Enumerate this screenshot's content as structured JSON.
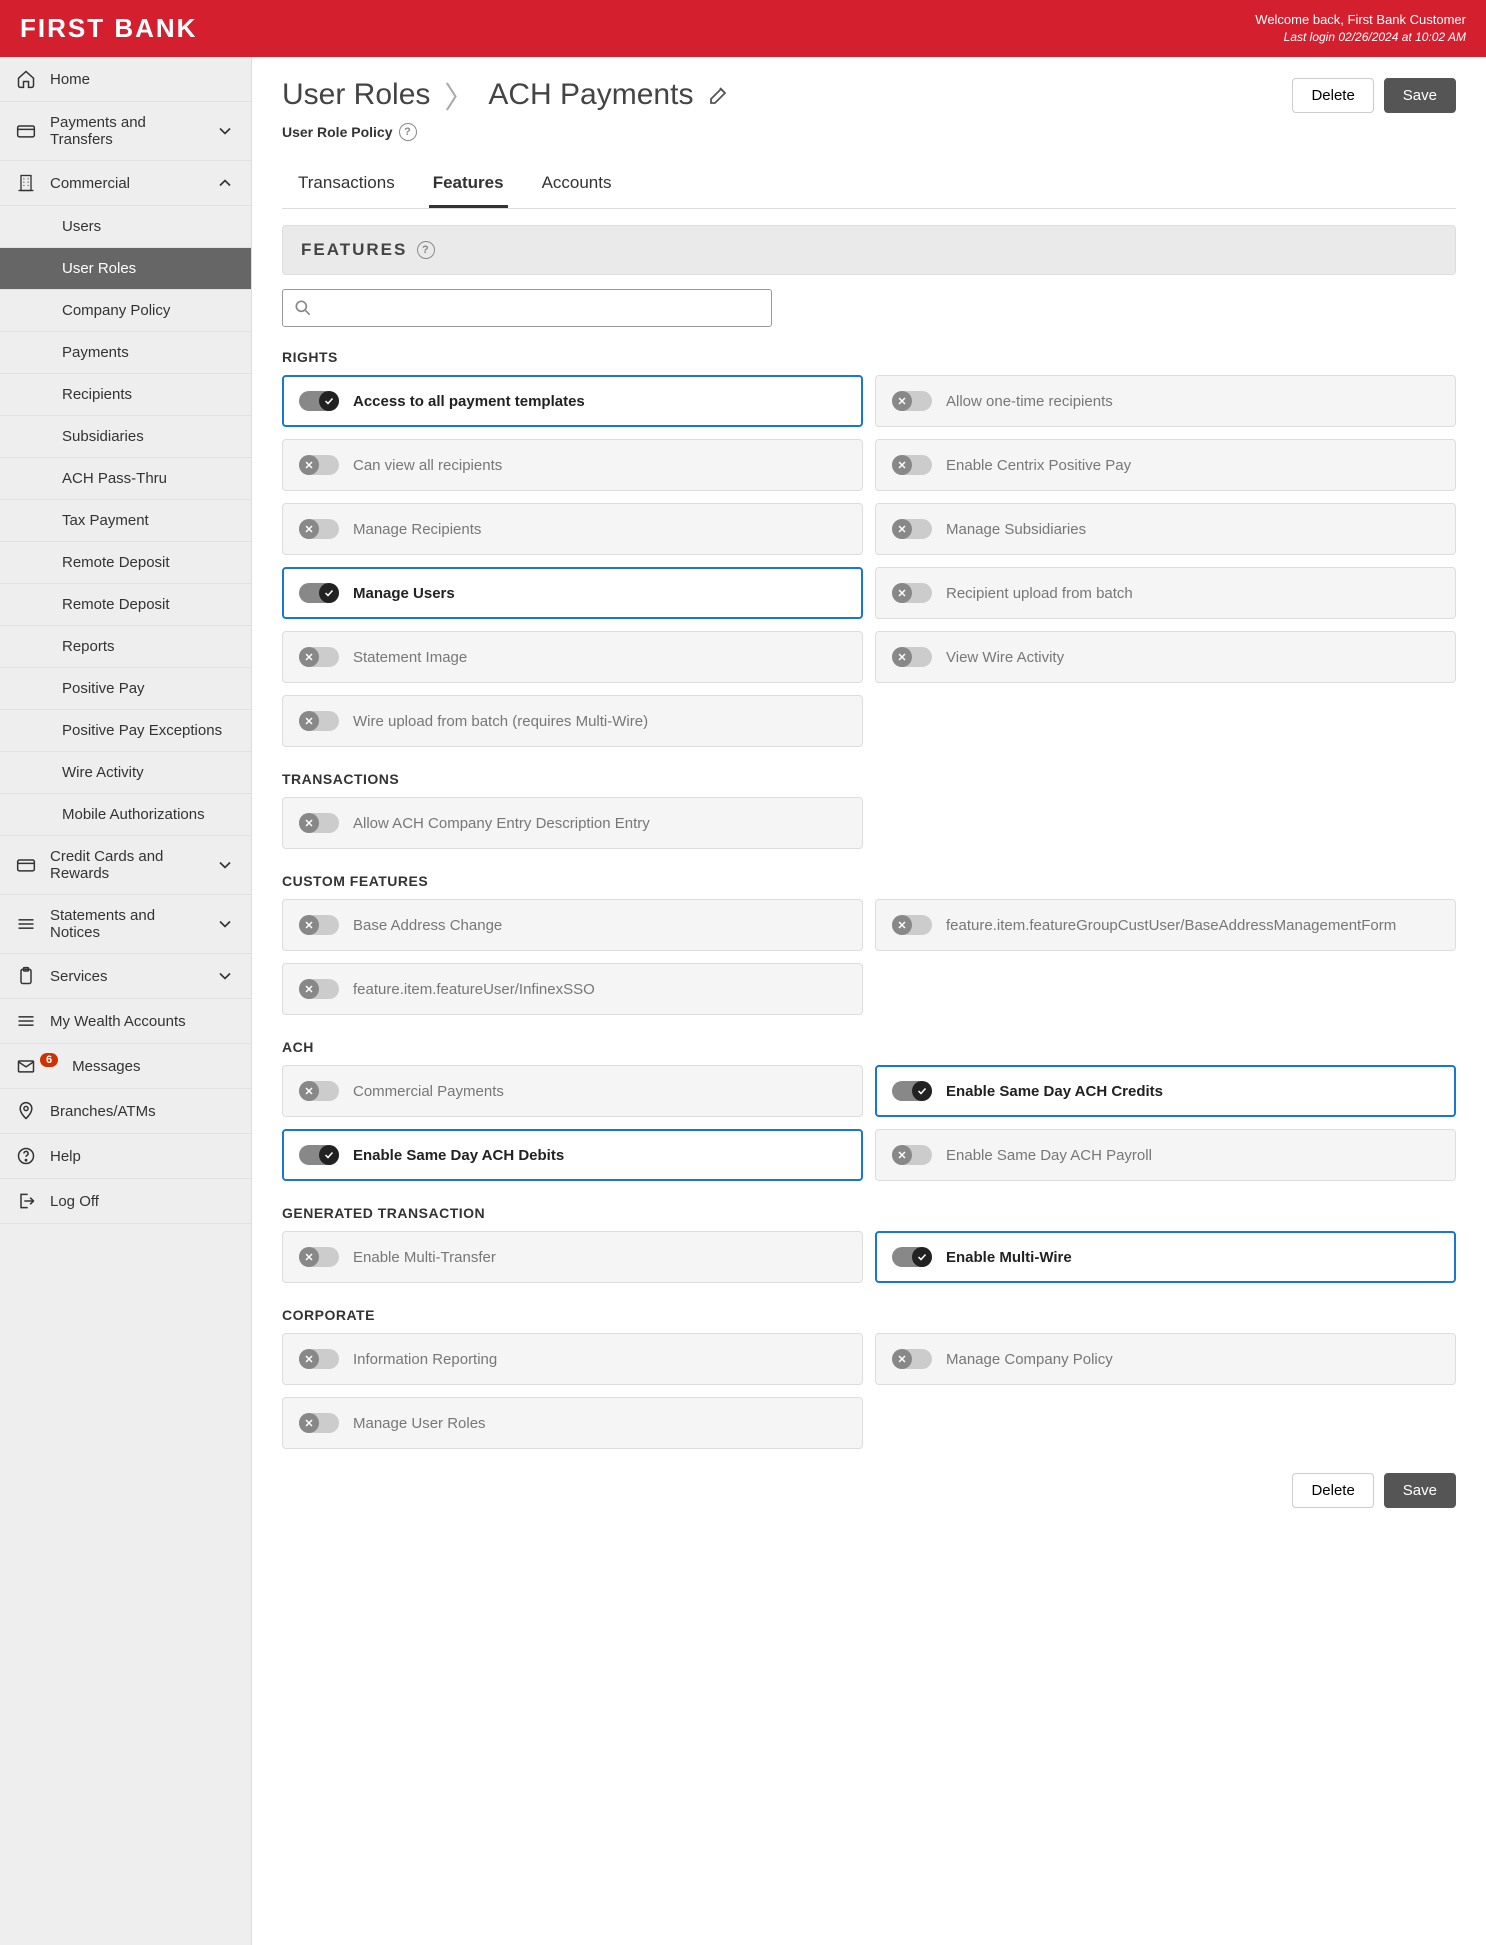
{
  "header": {
    "logo": "FIRST BANK",
    "welcome": "Welcome back, First Bank Customer",
    "last_login": "Last login 02/26/2024 at 10:02 AM"
  },
  "sidebar": {
    "home": "Home",
    "payments": "Payments and Transfers",
    "commercial": "Commercial",
    "sub": {
      "users": "Users",
      "user_roles": "User Roles",
      "company_policy": "Company Policy",
      "payments": "Payments",
      "recipients": "Recipients",
      "subsidiaries": "Subsidiaries",
      "ach_pass": "ACH Pass-Thru",
      "tax_payment": "Tax Payment",
      "remote_deposit1": "Remote Deposit",
      "remote_deposit2": "Remote Deposit",
      "reports": "Reports",
      "positive_pay": "Positive Pay",
      "positive_pay_exc": "Positive Pay Exceptions",
      "wire_activity": "Wire Activity",
      "mobile_auth": "Mobile Authorizations"
    },
    "credit_cards": "Credit Cards and Rewards",
    "statements": "Statements and Notices",
    "services": "Services",
    "wealth": "My Wealth Accounts",
    "messages": "Messages",
    "messages_badge": "6",
    "branches": "Branches/ATMs",
    "help": "Help",
    "logoff": "Log Off"
  },
  "breadcrumb": {
    "root": "User Roles",
    "current": "ACH Payments"
  },
  "subtitle": "User Role Policy",
  "buttons": {
    "delete": "Delete",
    "save": "Save"
  },
  "tabs": {
    "transactions": "Transactions",
    "features": "Features",
    "accounts": "Accounts"
  },
  "section_title": "FEATURES",
  "search_placeholder": "",
  "groups": {
    "rights": "RIGHTS",
    "transactions": "TRANSACTIONS",
    "custom": "CUSTOM FEATURES",
    "ach": "ACH",
    "generated": "GENERATED TRANSACTION",
    "corporate": "CORPORATE"
  },
  "features": {
    "rights": [
      {
        "label": "Access to all payment templates",
        "on": true
      },
      {
        "label": "Allow one-time recipients",
        "on": false
      },
      {
        "label": "Can view all recipients",
        "on": false
      },
      {
        "label": "Enable Centrix Positive Pay",
        "on": false
      },
      {
        "label": "Manage Recipients",
        "on": false
      },
      {
        "label": "Manage Subsidiaries",
        "on": false
      },
      {
        "label": "Manage Users",
        "on": true
      },
      {
        "label": "Recipient upload from batch",
        "on": false
      },
      {
        "label": "Statement Image",
        "on": false
      },
      {
        "label": "View Wire Activity",
        "on": false
      },
      {
        "label": "Wire upload from batch (requires Multi-Wire)",
        "on": false
      }
    ],
    "transactions": [
      {
        "label": "Allow ACH Company Entry Description Entry",
        "on": false
      }
    ],
    "custom": [
      {
        "label": "Base Address Change",
        "on": false
      },
      {
        "label": "feature.item.featureGroupCustUser/BaseAddressManagementForm",
        "on": false
      },
      {
        "label": "feature.item.featureUser/InfinexSSO",
        "on": false
      }
    ],
    "ach": [
      {
        "label": "Commercial Payments",
        "on": false
      },
      {
        "label": "Enable Same Day ACH Credits",
        "on": true
      },
      {
        "label": "Enable Same Day ACH Debits",
        "on": true
      },
      {
        "label": "Enable Same Day ACH Payroll",
        "on": false
      }
    ],
    "generated": [
      {
        "label": "Enable Multi-Transfer",
        "on": false
      },
      {
        "label": "Enable Multi-Wire",
        "on": true
      }
    ],
    "corporate": [
      {
        "label": "Information Reporting",
        "on": false
      },
      {
        "label": "Manage Company Policy",
        "on": false
      },
      {
        "label": "Manage User Roles",
        "on": false
      }
    ]
  }
}
